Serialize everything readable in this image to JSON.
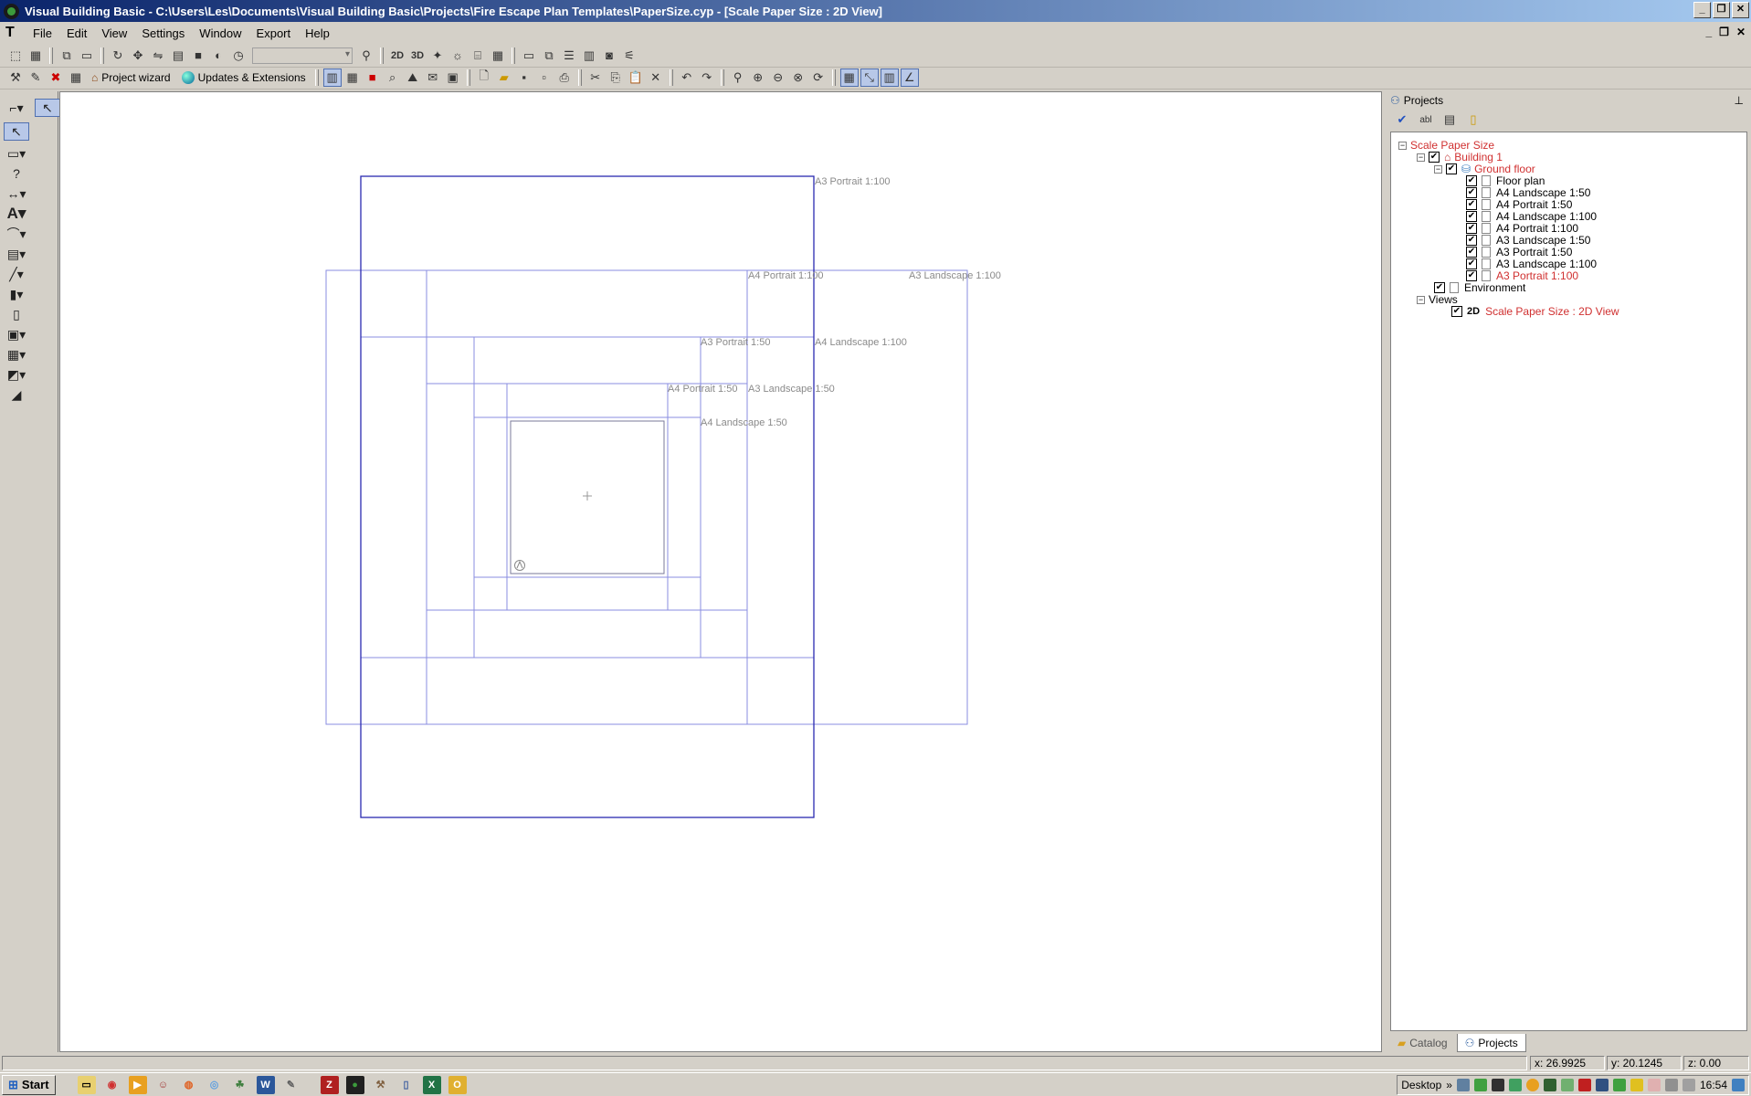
{
  "window": {
    "title": "Visual Building Basic - C:\\Users\\Les\\Documents\\Visual Building Basic\\Projects\\Fire Escape Plan Templates\\PaperSize.cyp - [Scale Paper Size : 2D View]"
  },
  "menu": [
    "File",
    "Edit",
    "View",
    "Settings",
    "Window",
    "Export",
    "Help"
  ],
  "toolbar": {
    "project_wizard": "Project wizard",
    "updates": "Updates & Extensions",
    "btn_2d": "2D",
    "btn_3d": "3D"
  },
  "canvas": {
    "paper_labels": [
      "A3 Portrait 1:100",
      "A4 Portrait 1:100",
      "A3 Landscape 1:100",
      "A3 Portrait 1:50",
      "A4 Landscape 1:100",
      "A4 Portrait 1:50",
      "A3 Landscape 1:50",
      "A4 Landscape 1:50"
    ]
  },
  "panel": {
    "title": "Projects",
    "tree": {
      "root": "Scale Paper Size",
      "building": "Building 1",
      "floor": "Ground floor",
      "layers": [
        "Floor plan",
        "A4 Landscape 1:50",
        "A4 Portrait 1:50",
        "A4 Landscape 1:100",
        "A4 Portrait 1:100",
        "A3 Landscape 1:50",
        "A3 Portrait 1:50",
        "A3 Landscape 1:100",
        "A3 Portrait 1:100"
      ],
      "environment": "Environment",
      "views": "Views",
      "view_badge": "2D",
      "view_item": "Scale Paper Size : 2D View"
    },
    "tabs": [
      "Catalog",
      "Projects"
    ]
  },
  "status": {
    "x": "x: 26.9925",
    "y": "y: 20.1245",
    "z": "z: 0.00"
  },
  "taskbar": {
    "start": "Start",
    "desktop": "Desktop",
    "clock": "16:54"
  }
}
